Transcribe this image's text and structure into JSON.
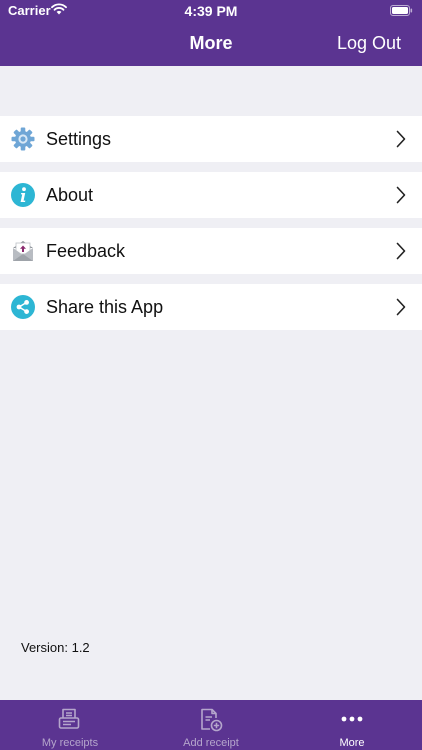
{
  "status_bar": {
    "carrier": "Carrier",
    "time": "4:39 PM"
  },
  "nav": {
    "title": "More",
    "logout_label": "Log Out"
  },
  "menu": {
    "items": [
      {
        "label": "Settings",
        "icon": "gear-icon"
      },
      {
        "label": "About",
        "icon": "info-icon"
      },
      {
        "label": "Feedback",
        "icon": "envelope-icon"
      },
      {
        "label": "Share this App",
        "icon": "share-icon"
      }
    ]
  },
  "version_text": "Version: 1.2",
  "tabbar": {
    "tabs": [
      {
        "label": "My receipts",
        "icon": "receipt-icon",
        "active": false
      },
      {
        "label": "Add receipt",
        "icon": "add-document-icon",
        "active": false
      },
      {
        "label": "More",
        "icon": "more-icon",
        "active": true
      }
    ]
  },
  "colors": {
    "brand": "#5b3491",
    "background": "#efeff4",
    "icon_teal": "#2db6d4",
    "tab_inactive": "#b5a6cc"
  }
}
